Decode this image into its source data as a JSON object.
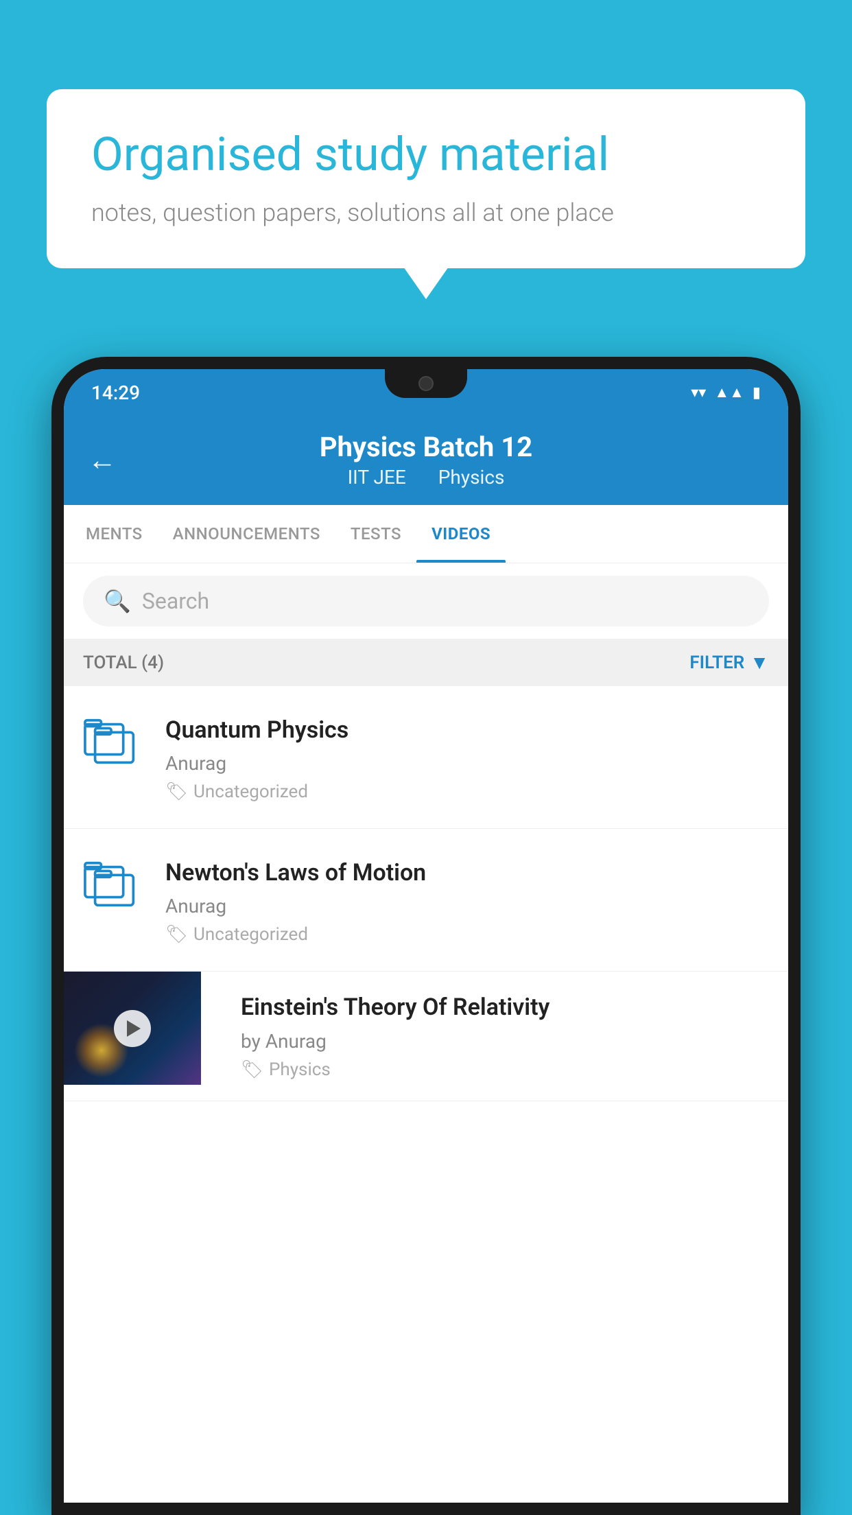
{
  "background_color": "#29B6D8",
  "speech_bubble": {
    "title": "Organised study material",
    "subtitle": "notes, question papers, solutions all at one place"
  },
  "status_bar": {
    "time": "14:29",
    "wifi": "▾",
    "signal": "▴",
    "battery": "▮"
  },
  "header": {
    "back_label": "←",
    "title": "Physics Batch 12",
    "subtitle_part1": "IIT JEE",
    "subtitle_part2": "Physics"
  },
  "tabs": [
    {
      "label": "MENTS",
      "active": false
    },
    {
      "label": "ANNOUNCEMENTS",
      "active": false
    },
    {
      "label": "TESTS",
      "active": false
    },
    {
      "label": "VIDEOS",
      "active": true
    }
  ],
  "search": {
    "placeholder": "Search"
  },
  "filter_bar": {
    "total_label": "TOTAL (4)",
    "filter_label": "FILTER"
  },
  "videos": [
    {
      "title": "Quantum Physics",
      "author": "Anurag",
      "tag": "Uncategorized",
      "has_thumbnail": false
    },
    {
      "title": "Newton's Laws of Motion",
      "author": "Anurag",
      "tag": "Uncategorized",
      "has_thumbnail": false
    },
    {
      "title": "Einstein's Theory Of Relativity",
      "author": "by Anurag",
      "tag": "Physics",
      "has_thumbnail": true
    }
  ]
}
